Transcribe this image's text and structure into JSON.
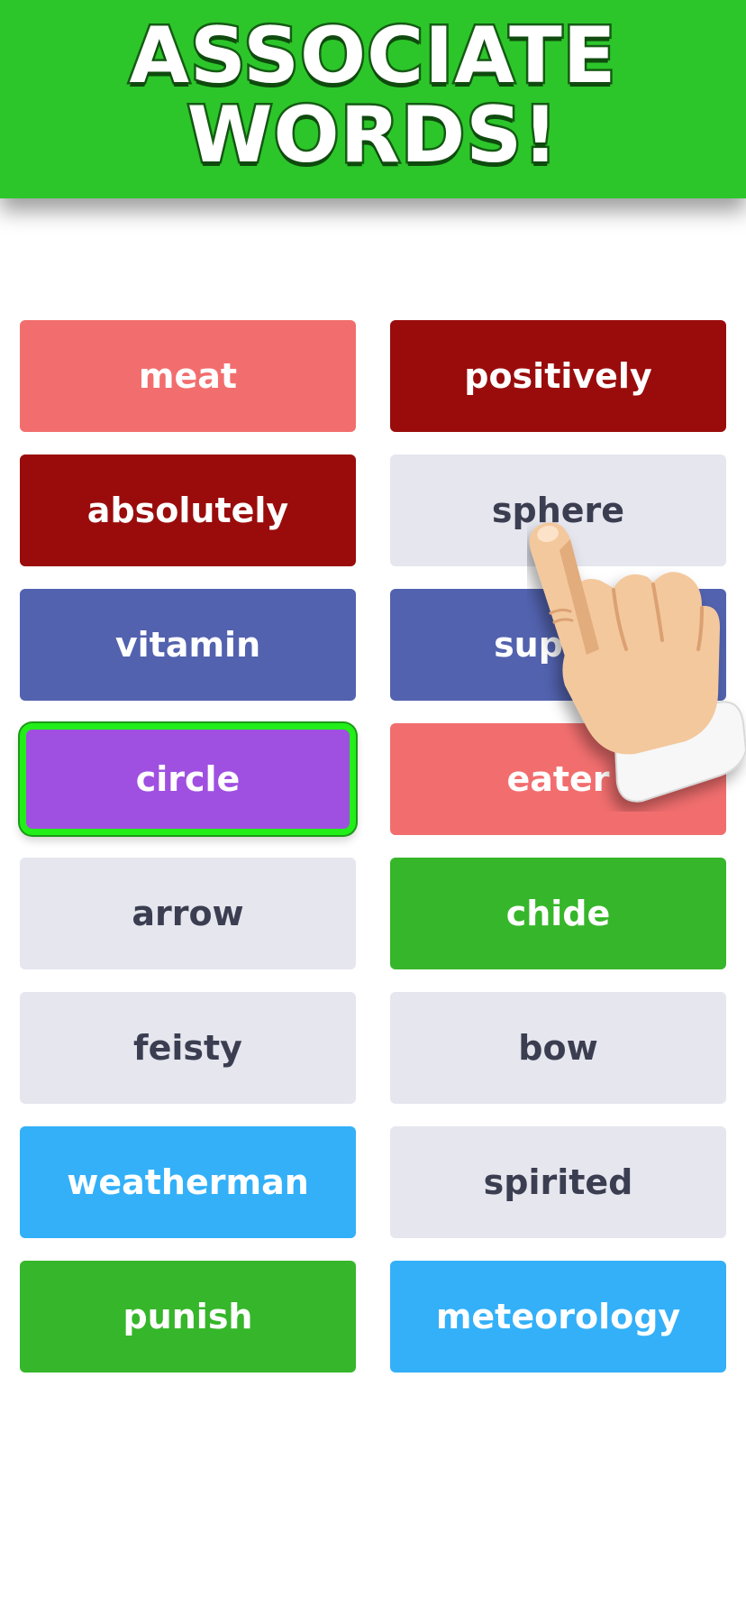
{
  "banner": {
    "title_line1": "ASSOCIATE",
    "title_line2": "WORDS!"
  },
  "colors": {
    "banner_green": "#2cc62a",
    "salmon": "#f26e6e",
    "dark_red": "#9a0c0c",
    "grey": "#e5e6ee",
    "indigo": "#5262ae",
    "purple": "#a050e0",
    "green": "#36b62a",
    "sky_blue": "#33b0f8",
    "selection_outline": "#22ee1a"
  },
  "tiles": [
    {
      "label": "meat",
      "color": "salmon",
      "selected": false
    },
    {
      "label": "positively",
      "color": "dark_red",
      "selected": false
    },
    {
      "label": "absolutely",
      "color": "dark_red",
      "selected": false
    },
    {
      "label": "sphere",
      "color": "grey",
      "selected": false
    },
    {
      "label": "vitamin",
      "color": "indigo",
      "selected": false
    },
    {
      "label": "supple",
      "color": "indigo",
      "selected": false
    },
    {
      "label": "circle",
      "color": "purple",
      "selected": true
    },
    {
      "label": "eater",
      "color": "salmon",
      "selected": false
    },
    {
      "label": "arrow",
      "color": "grey",
      "selected": false
    },
    {
      "label": "chide",
      "color": "green",
      "selected": false
    },
    {
      "label": "feisty",
      "color": "grey",
      "selected": false
    },
    {
      "label": "bow",
      "color": "grey",
      "selected": false
    },
    {
      "label": "weatherman",
      "color": "sky_blue",
      "selected": false
    },
    {
      "label": "spirited",
      "color": "grey",
      "selected": false
    },
    {
      "label": "punish",
      "color": "green",
      "selected": false
    },
    {
      "label": "meteorology",
      "color": "sky_blue",
      "selected": false
    }
  ],
  "overlay": {
    "icon": "pointing-hand-icon"
  }
}
